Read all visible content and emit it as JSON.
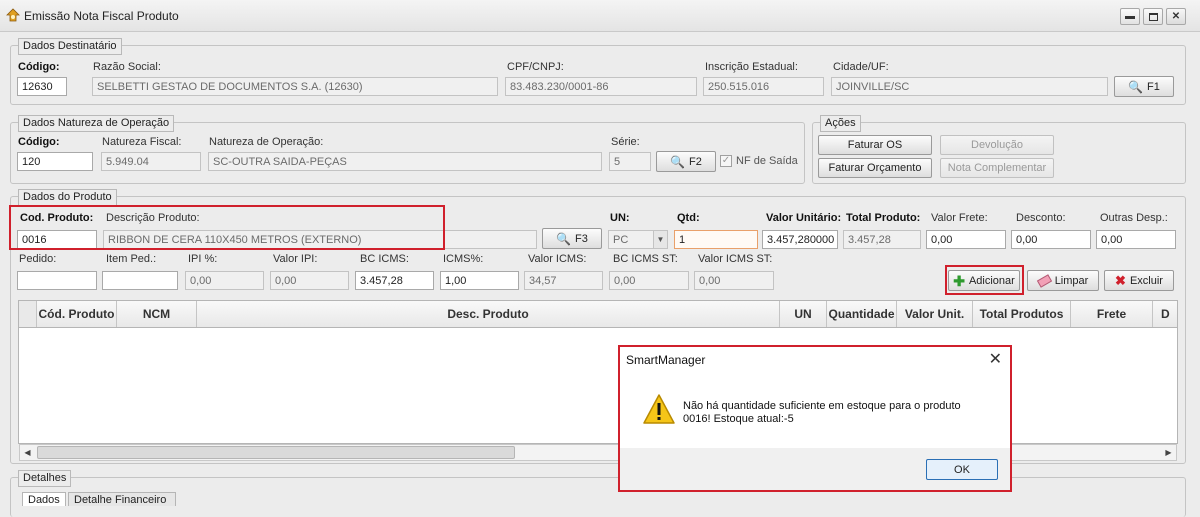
{
  "window": {
    "title": "Emissão Nota Fiscal Produto"
  },
  "destinatario": {
    "group_title": "Dados Destinatário",
    "codigo_label": "Código:",
    "codigo_value": "12630",
    "razao_label": "Razão Social:",
    "razao_value": "SELBETTI GESTAO DE DOCUMENTOS S.A. (12630)",
    "cpf_label": "CPF/CNPJ:",
    "cpf_value": "83.483.230/0001-86",
    "ie_label": "Inscrição Estadual:",
    "ie_value": "250.515.016",
    "cidade_label": "Cidade/UF:",
    "cidade_value": "JOINVILLE/SC",
    "f1_label": "F1"
  },
  "natureza": {
    "group_title": "Dados Natureza de Operação",
    "codigo_label": "Código:",
    "codigo_value": "120",
    "nf_label": "Natureza Fiscal:",
    "nf_value": "5.949.04",
    "op_label": "Natureza de Operação:",
    "op_value": "SC-OUTRA SAIDA-PEÇAS",
    "serie_label": "Série:",
    "serie_value": "5",
    "f2_label": "F2",
    "nf_saida_label": "NF de Saída"
  },
  "acoes": {
    "group_title": "Ações",
    "faturar_os": "Faturar OS",
    "devolucao": "Devolução",
    "faturar_orcamento": "Faturar Orçamento",
    "nota_complementar": "Nota Complementar"
  },
  "produto": {
    "group_title": "Dados do Produto",
    "cod_label": "Cod. Produto:",
    "cod_value": "0016",
    "desc_label": "Descrição Produto:",
    "desc_value": "RIBBON DE CERA 110X450 METROS (EXTERNO)",
    "f3_label": "F3",
    "un_label": "UN:",
    "un_value": "PC",
    "qtd_label": "Qtd:",
    "qtd_value": "1",
    "vu_label": "Valor Unitário:",
    "vu_value": "3.457,280000",
    "tp_label": "Total Produto:",
    "tp_value": "3.457,28",
    "frete_label": "Valor Frete:",
    "frete_value": "0,00",
    "desconto_label": "Desconto:",
    "desconto_value": "0,00",
    "outras_label": "Outras Desp.:",
    "outras_value": "0,00",
    "pedido_label": "Pedido:",
    "pedido_value": "",
    "itemped_label": "Item Ped.:",
    "itemped_value": "",
    "ipi_label": "IPI %:",
    "ipi_value": "0,00",
    "vipi_label": "Valor IPI:",
    "vipi_value": "0,00",
    "bc_label": "BC ICMS:",
    "bc_value": "3.457,28",
    "icms_label": "ICMS%:",
    "icms_value": "1,00",
    "vicms_label": "Valor ICMS:",
    "vicms_value": "34,57",
    "bcst_label": "BC ICMS ST:",
    "bcst_value": "0,00",
    "vicmsst_label": "Valor ICMS ST:",
    "vicmsst_value": "0,00",
    "adicionar": "Adicionar",
    "limpar": "Limpar",
    "excluir": "Excluir"
  },
  "grid": {
    "columns": [
      "Cód. Produto",
      "NCM",
      "Desc. Produto",
      "UN",
      "Quantidade",
      "Valor Unit.",
      "Total Produtos",
      "Frete",
      "D"
    ]
  },
  "detalhes": {
    "group_title": "Detalhes",
    "tabs": [
      "Dados",
      "Detalhe Financeiro"
    ]
  },
  "dialog": {
    "title": "SmartManager",
    "message_line1": "Não há quantidade suficiente em estoque para o produto",
    "message_line2": "0016! Estoque atual:-5",
    "ok": "OK"
  },
  "colors": {
    "highlight": "#d0202c",
    "window_bg": "#ececec"
  }
}
